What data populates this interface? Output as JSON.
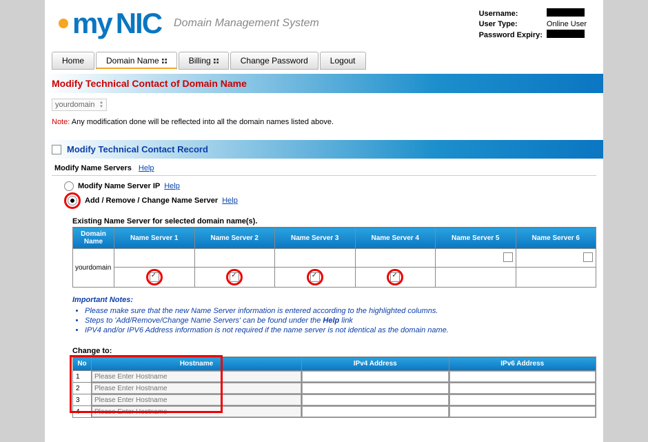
{
  "header": {
    "logo_prefix": "my",
    "logo_suffix": "NIC",
    "tagline": "Domain Management System",
    "user": {
      "username_label": "Username:",
      "usertype_label": "User Type:",
      "usertype_value": "Online User",
      "expiry_label": "Password Expiry:"
    }
  },
  "nav": {
    "home": "Home",
    "domain": "Domain Name",
    "billing": "Billing",
    "change_pw": "Change Password",
    "logout": "Logout"
  },
  "page_title": "Modify Technical Contact of Domain Name",
  "domain_value": "yourdomain",
  "note_label": "Note:",
  "note_text": "Any modification done will be reflected into all the domain names listed above.",
  "section_toggle": "Modify Technical Contact Record",
  "subhead": "Modify Name Servers",
  "help": "Help",
  "radio": {
    "opt1": "Modify Name Server IP",
    "opt2": "Add / Remove / Change Name Server"
  },
  "ns_table": {
    "caption": "Existing Name Server for selected domain name(s).",
    "headers": {
      "dn": "Domain Name",
      "n1": "Name Server 1",
      "n2": "Name Server 2",
      "n3": "Name Server 3",
      "n4": "Name Server 4",
      "n5": "Name Server 5",
      "n6": "Name Server 6"
    },
    "row_domain": "yourdomain"
  },
  "important": {
    "heading": "Important Notes:",
    "li1": "Please make sure that the new Name Server information is entered according to the highlighted columns.",
    "li2a": "Steps to 'Add/Remove/Change Name Servers' can be found under the ",
    "li2b": "Help",
    "li2c": " link",
    "li3": "IPV4 and/or IPV6 Address information is not required if the name server is not identical as the domain name."
  },
  "change": {
    "label": "Change to:",
    "headers": {
      "num": "No",
      "host": "Hostname",
      "ipv4": "IPv4 Address",
      "ipv6": "IPv6 Address"
    },
    "rows": [
      {
        "n": "1",
        "ph": "Please Enter Hostname"
      },
      {
        "n": "2",
        "ph": "Please Enter Hostname"
      },
      {
        "n": "3",
        "ph": "Please Enter Hostname"
      },
      {
        "n": "4",
        "ph": "Please Enter Hostname"
      }
    ]
  }
}
